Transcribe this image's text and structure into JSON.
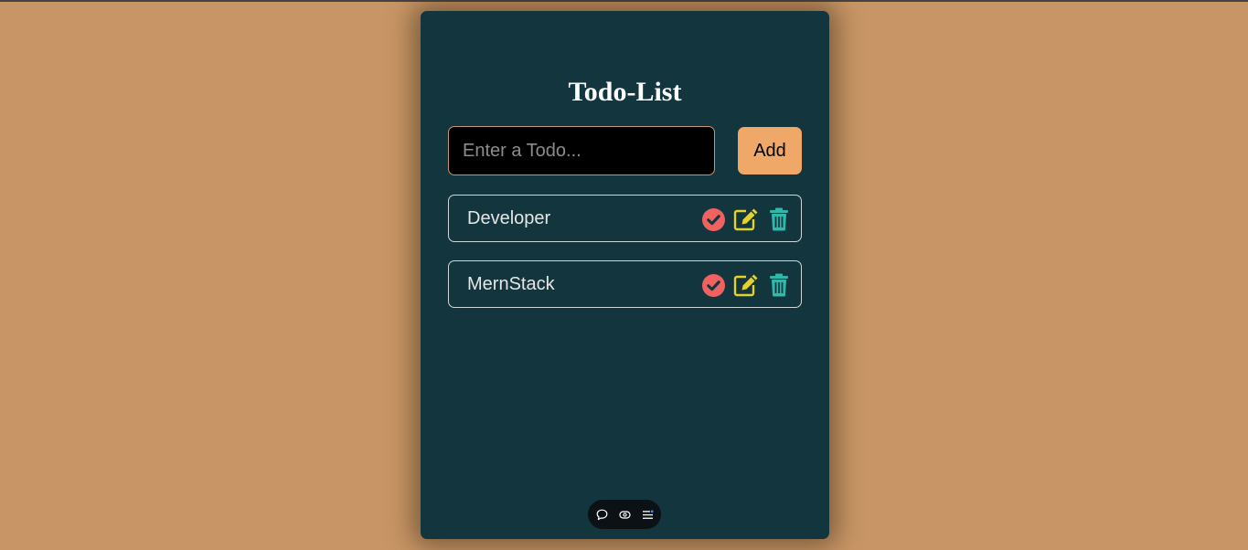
{
  "app": {
    "title": "Todo-List"
  },
  "input": {
    "placeholder": "Enter a Todo...",
    "value": ""
  },
  "add_button": {
    "label": "Add"
  },
  "todos": [
    {
      "text": "Developer"
    },
    {
      "text": "MernStack"
    }
  ],
  "icons": {
    "complete": "check-circle-icon",
    "edit": "edit-icon",
    "delete": "trash-icon",
    "toolbar": [
      "comment-icon",
      "eye-icon",
      "menu-icon"
    ]
  },
  "colors": {
    "page_background": "#c89666",
    "card_background": "#13353d",
    "add_button": "#f0a868",
    "complete_icon": "#f06260",
    "edit_icon": "#e4d22a",
    "delete_icon": "#2fb8aa"
  }
}
